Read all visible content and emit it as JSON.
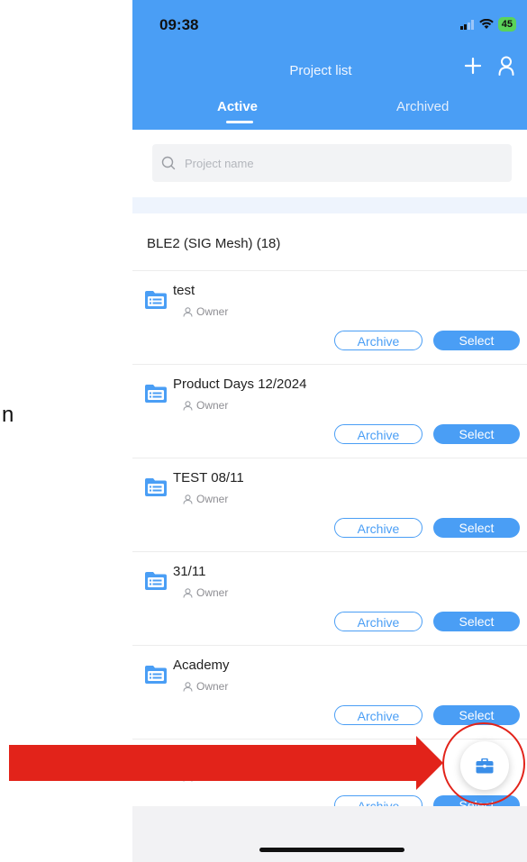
{
  "outside": {
    "stray_letter": "n"
  },
  "status_bar": {
    "time": "09:38",
    "battery": "45"
  },
  "header": {
    "title": "Project list"
  },
  "tabs": [
    {
      "label": "Active",
      "selected": true
    },
    {
      "label": "Archived",
      "selected": false
    }
  ],
  "search": {
    "placeholder": "Project name",
    "value": ""
  },
  "group": {
    "title": "BLE2 (SIG Mesh) (18)"
  },
  "buttons": {
    "archive": "Archive",
    "select": "Select"
  },
  "projects": [
    {
      "name": "test",
      "role": "Owner"
    },
    {
      "name": "Product Days 12/2024",
      "role": "Owner"
    },
    {
      "name": "TEST 08/11",
      "role": "Owner"
    },
    {
      "name": "31/11",
      "role": "Owner"
    },
    {
      "name": "Academy",
      "role": "Owner"
    },
    {
      "name": "",
      "role": "Owner"
    }
  ],
  "colors": {
    "accent": "#4a9ef5",
    "annotation": "#e2231a"
  },
  "icons": {
    "add": "plus-icon",
    "profile": "user-icon",
    "search": "search-icon",
    "folder": "folder-list-icon",
    "role": "person-icon",
    "fab": "briefcase-icon"
  }
}
